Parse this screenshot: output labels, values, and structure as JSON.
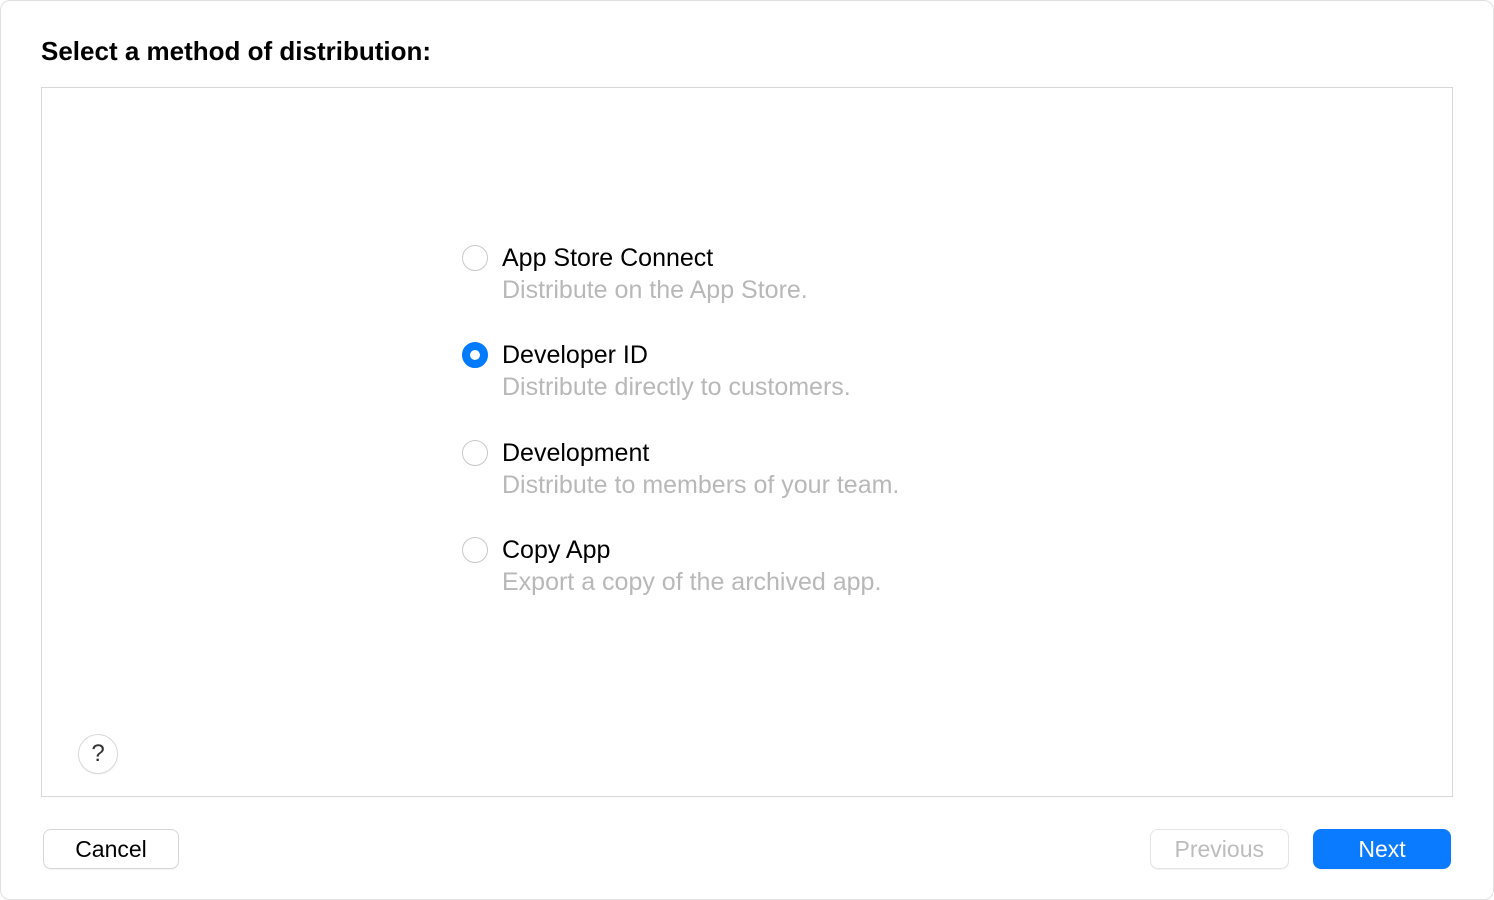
{
  "heading": "Select a method of distribution:",
  "options": [
    {
      "title": "App Store Connect",
      "desc": "Distribute on the App Store.",
      "selected": false
    },
    {
      "title": "Developer ID",
      "desc": "Distribute directly to customers.",
      "selected": true
    },
    {
      "title": "Development",
      "desc": "Distribute to members of your team.",
      "selected": false
    },
    {
      "title": "Copy App",
      "desc": "Export a copy of the archived app.",
      "selected": false
    }
  ],
  "help_label": "?",
  "buttons": {
    "cancel": "Cancel",
    "previous": "Previous",
    "next": "Next"
  }
}
